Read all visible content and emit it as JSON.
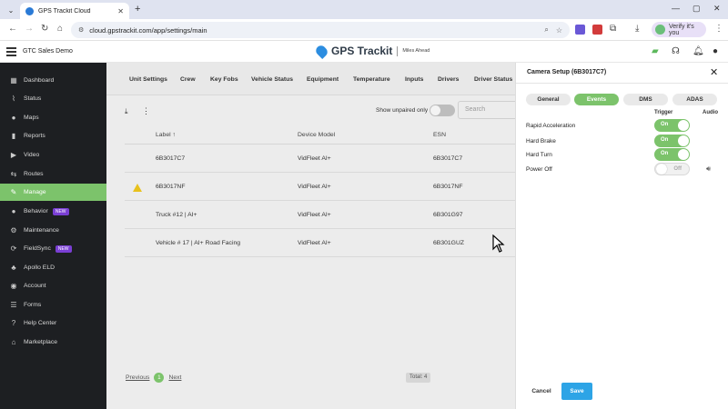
{
  "browser": {
    "tab_title": "GPS Trackit Cloud",
    "url": "cloud.gpstrackit.com/app/settings/main",
    "profile_label": "Verify it's you"
  },
  "header": {
    "account": "GTC Sales Demo",
    "brand": "GPS Trackit",
    "tagline": "Miles Ahead"
  },
  "sidebar": {
    "items": [
      {
        "label": "Dashboard",
        "icon": "dashboard-icon",
        "glyph": "▦"
      },
      {
        "label": "Status",
        "icon": "status-icon",
        "glyph": "⌇"
      },
      {
        "label": "Maps",
        "icon": "map-pin-icon",
        "glyph": "●"
      },
      {
        "label": "Reports",
        "icon": "reports-icon",
        "glyph": "▮"
      },
      {
        "label": "Video",
        "icon": "video-icon",
        "glyph": "▶"
      },
      {
        "label": "Routes",
        "icon": "routes-icon",
        "glyph": "⇆"
      },
      {
        "label": "Manage",
        "icon": "wrench-icon",
        "glyph": "✎"
      },
      {
        "label": "Behavior",
        "icon": "behavior-icon",
        "glyph": "●",
        "badge": "NEW"
      },
      {
        "label": "Maintenance",
        "icon": "maintenance-icon",
        "glyph": "⚙"
      },
      {
        "label": "FieldSync",
        "icon": "fieldsync-icon",
        "glyph": "⟳",
        "badge": "NEW"
      },
      {
        "label": "Apollo ELD",
        "icon": "apollo-icon",
        "glyph": "♣"
      },
      {
        "label": "Account",
        "icon": "account-icon",
        "glyph": "◉"
      },
      {
        "label": "Forms",
        "icon": "forms-icon",
        "glyph": "☰"
      },
      {
        "label": "Help Center",
        "icon": "help-icon",
        "glyph": "?"
      },
      {
        "label": "Marketplace",
        "icon": "marketplace-icon",
        "glyph": "⌂"
      }
    ],
    "active_index": 6
  },
  "main": {
    "tabs": [
      "Unit Settings",
      "Crew",
      "Key Fobs",
      "Vehicle Status",
      "Equipment",
      "Temperature",
      "Inputs",
      "Drivers",
      "Driver Status"
    ],
    "show_unpaired_label": "Show unpaired only",
    "search_placeholder": "Search",
    "columns": [
      "Label",
      "Device Model",
      "ESN"
    ],
    "rows": [
      {
        "label": "6B3017C7",
        "model": "VidFleet AI+",
        "esn": "6B3017C7",
        "warning": false
      },
      {
        "label": "6B3017NF",
        "model": "VidFleet AI+",
        "esn": "6B3017NF",
        "warning": true
      },
      {
        "label": "Truck #12 | AI+",
        "model": "VidFleet AI+",
        "esn": "6B301G97",
        "warning": false
      },
      {
        "label": "Vehicle # 17 | AI+ Road Facing",
        "model": "VidFleet AI+",
        "esn": "6B301GUZ",
        "warning": false
      }
    ],
    "pager": {
      "previous": "Previous",
      "page": "1",
      "next": "Next",
      "total": "Total: 4"
    }
  },
  "panel": {
    "title": "Camera Setup (6B3017C7)",
    "tabs": [
      "General",
      "Events",
      "DMS",
      "ADAS"
    ],
    "active_tab": 1,
    "col_trigger": "Trigger",
    "col_audio": "Audio",
    "events": [
      {
        "label": "Rapid Acceleration",
        "state": "On",
        "on": true
      },
      {
        "label": "Hard Brake",
        "state": "On",
        "on": true
      },
      {
        "label": "Hard Turn",
        "state": "On",
        "on": true
      },
      {
        "label": "Power Off",
        "state": "Off",
        "on": false
      }
    ],
    "cancel_label": "Cancel",
    "save_label": "Save"
  },
  "colors": {
    "accent_green": "#7cc36b",
    "save_blue": "#2da4e6",
    "sidebar_bg": "#1d1f22",
    "badge_purple": "#7a3fd4"
  }
}
